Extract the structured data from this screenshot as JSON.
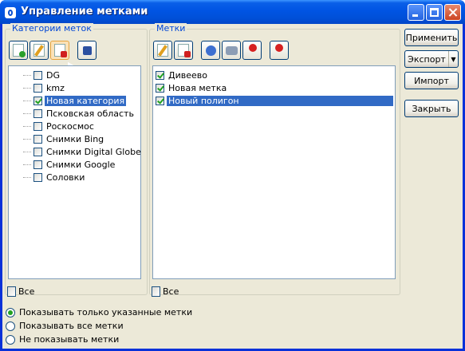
{
  "window": {
    "title": "Управление метками"
  },
  "categories": {
    "group_label": "Категории меток",
    "items": [
      {
        "label": "DG",
        "checked": false
      },
      {
        "label": "kmz",
        "checked": false
      },
      {
        "label": "Новая категория",
        "checked": true,
        "selected": true
      },
      {
        "label": "Псковская область",
        "checked": false
      },
      {
        "label": "Роскосмос",
        "checked": false
      },
      {
        "label": "Снимки Bing",
        "checked": false
      },
      {
        "label": "Снимки Digital Globe",
        "checked": false
      },
      {
        "label": "Снимки Google",
        "checked": false
      },
      {
        "label": "Соловки",
        "checked": false
      }
    ],
    "all_label": "Все"
  },
  "marks": {
    "group_label": "Метки",
    "items": [
      {
        "label": "Дивеево",
        "checked": true
      },
      {
        "label": "Новая метка",
        "checked": true
      },
      {
        "label": "Новый полигон",
        "checked": true,
        "selected": true
      }
    ],
    "all_label": "Все"
  },
  "buttons": {
    "apply": "Применить",
    "export": "Экспорт",
    "import": "Импорт",
    "close": "Закрыть"
  },
  "radios": [
    {
      "label": "Показывать только указанные метки",
      "selected": true
    },
    {
      "label": "Показывать все метки",
      "selected": false
    },
    {
      "label": "Не показывать метки",
      "selected": false
    }
  ],
  "colors": {
    "selection": "#316ac5",
    "titlebar": "#0054e3",
    "group_label": "#0046d5"
  }
}
